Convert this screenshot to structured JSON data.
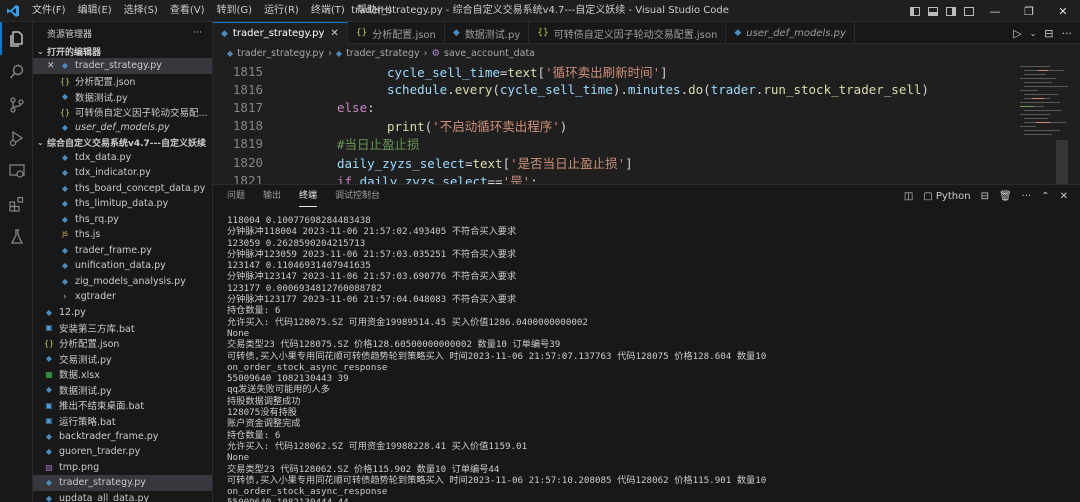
{
  "titlebar": {
    "menu": [
      "文件(F)",
      "编辑(E)",
      "选择(S)",
      "查看(V)",
      "转到(G)",
      "运行(R)",
      "终端(T)",
      "帮助(H)"
    ],
    "title": "trader_strategy.py - 综合自定义交易系统v4.7---自定义妖续 - Visual Studio Code"
  },
  "sidebar": {
    "header": "资源管理器",
    "more": "···",
    "open_editors_title": "打开的编辑器",
    "open_editors": [
      {
        "label": "trader_strategy.py",
        "kind": "py"
      },
      {
        "label": "分析配置.json",
        "kind": "json"
      },
      {
        "label": "数据测试.py",
        "kind": "py"
      },
      {
        "label": "可转债自定义因子轮动交易配...",
        "kind": "json"
      },
      {
        "label": "user_def_models.py",
        "kind": "py"
      }
    ],
    "workspace_title": "综合自定义交易系统v4.7---自定义妖续",
    "files": [
      {
        "label": "tdx_data.py",
        "kind": "py"
      },
      {
        "label": "tdx_indicator.py",
        "kind": "py"
      },
      {
        "label": "ths_board_concept_data.py",
        "kind": "py"
      },
      {
        "label": "ths_limitup_data.py",
        "kind": "py"
      },
      {
        "label": "ths_rq.py",
        "kind": "py"
      },
      {
        "label": "ths.js",
        "kind": "js"
      },
      {
        "label": "trader_frame.py",
        "kind": "py"
      },
      {
        "label": "unification_data.py",
        "kind": "py"
      },
      {
        "label": "zig_models_analysis.py",
        "kind": "py"
      },
      {
        "label": "xgtrader",
        "kind": "folder"
      },
      {
        "label": "12.py",
        "kind": "py"
      },
      {
        "label": "安装第三方库.bat",
        "kind": "bat"
      },
      {
        "label": "分析配置.json",
        "kind": "json"
      },
      {
        "label": "交易测试.py",
        "kind": "py"
      },
      {
        "label": "数据.xlsx",
        "kind": "xlsx"
      },
      {
        "label": "数据测试.py",
        "kind": "py"
      },
      {
        "label": "推出不结束桌面.bat",
        "kind": "bat"
      },
      {
        "label": "运行策略.bat",
        "kind": "bat"
      },
      {
        "label": "backtrader_frame.py",
        "kind": "py"
      },
      {
        "label": "guoren_trader.py",
        "kind": "py"
      },
      {
        "label": "tmp.png",
        "kind": "png"
      },
      {
        "label": "trader_strategy.py",
        "kind": "py"
      },
      {
        "label": "updata_all_data.py",
        "kind": "py"
      }
    ]
  },
  "tabs": [
    {
      "label": "trader_strategy.py",
      "kind": "py"
    },
    {
      "label": "分析配置.json",
      "kind": "json"
    },
    {
      "label": "数据测试.py",
      "kind": "py"
    },
    {
      "label": "可转债自定义因子轮动交易配置.json",
      "kind": "json"
    },
    {
      "label": "user_def_models.py",
      "kind": "py"
    }
  ],
  "breadcrumb": [
    "trader_strategy.py",
    "trader_strategy",
    "save_account_data"
  ],
  "code": {
    "lines": [
      {
        "n": "1815",
        "parts": [
          [
            "v",
            "cycle_sell_time"
          ],
          [
            "p",
            "="
          ],
          [
            "f",
            "text"
          ],
          [
            "p",
            "["
          ],
          [
            "s",
            "'循环卖出刷新时间'"
          ],
          [
            "p",
            "]"
          ]
        ],
        "indent": 1
      },
      {
        "n": "1816",
        "parts": [
          [
            "v",
            "schedule"
          ],
          [
            "p",
            "."
          ],
          [
            "f",
            "every"
          ],
          [
            "p",
            "("
          ],
          [
            "v",
            "cycle_sell_time"
          ],
          [
            "p",
            ")."
          ],
          [
            "v",
            "minutes"
          ],
          [
            "p",
            "."
          ],
          [
            "f",
            "do"
          ],
          [
            "p",
            "("
          ],
          [
            "v",
            "trader"
          ],
          [
            "p",
            "."
          ],
          [
            "f",
            "run_stock_trader_sell"
          ],
          [
            "p",
            ")"
          ]
        ],
        "indent": 1
      },
      {
        "n": "1817",
        "parts": [
          [
            "k",
            "else"
          ],
          [
            "p",
            ":"
          ]
        ],
        "indent": 0
      },
      {
        "n": "1818",
        "parts": [
          [
            "f",
            "print"
          ],
          [
            "p",
            "("
          ],
          [
            "s",
            "'不启动循环卖出程序'"
          ],
          [
            "p",
            ")"
          ]
        ],
        "indent": 1
      },
      {
        "n": "1819",
        "parts": [
          [
            "cm",
            "#当日止盈止损"
          ]
        ],
        "indent": 0
      },
      {
        "n": "1820",
        "parts": [
          [
            "v",
            "daily_zyzs_select"
          ],
          [
            "p",
            "="
          ],
          [
            "f",
            "text"
          ],
          [
            "p",
            "["
          ],
          [
            "s",
            "'是否当日止盈止损'"
          ],
          [
            "p",
            "]"
          ]
        ],
        "indent": 0
      },
      {
        "n": "1821",
        "parts": [
          [
            "k",
            "if"
          ],
          [
            "p",
            " "
          ],
          [
            "v",
            "daily_zyzs_select"
          ],
          [
            "p",
            "=="
          ],
          [
            "s",
            "'是'"
          ],
          [
            "p",
            ":"
          ]
        ],
        "indent": 0
      }
    ]
  },
  "panel": {
    "tabs": [
      "问题",
      "输出",
      "终端",
      "调试控制台"
    ],
    "active_tab": "终端",
    "shell": "Python",
    "terminal": [
      "118004 0.10077698284483438",
      "分钟脉冲118004 2023-11-06 21:57:02.493405 不符合买入要求",
      "123059 0.2628590204215713",
      "分钟脉冲123059 2023-11-06 21:57:03.035251 不符合买入要求",
      "123147 0.11046931407941635",
      "分钟脉冲123147 2023-11-06 21:57:03.690776 不符合买入要求",
      "123177 0.0006934812760088782",
      "分钟脉冲123177 2023-11-06 21:57:04.048083 不符合买入要求",
      "持仓数量: 6",
      "允许买入: 代码128075.SZ 可用资金19989514.45 买入价值1286.0400000000002",
      "None",
      "交易类型23 代码128075.SZ 价格128.60500000000002 数量10 订单编号39",
      "可转债,买入小果专用同花顺可转债趋势轮到策略买入 时间2023-11-06 21:57:07.137763 代码128075 价格128.604 数量10",
      "on_order_stock_async_response",
      "55009640 1082130443 39",
      "qq发送失败可能用的人多",
      "持股数据调整成功",
      "128075没有持股",
      "账户资金调整完成",
      "持仓数量: 6",
      "允许买入: 代码128062.SZ 可用资金19988228.41 买入价值1159.01",
      "None",
      "交易类型23 代码128062.SZ 价格115.902 数量10 订单编号44",
      "可转债,买入小果专用同花顺可转债趋势轮到策略买入 时间2023-11-06 21:57:10.208085 代码128062 价格115.901 数量10",
      "on_order_stock_async_response",
      "55009640 1082130444 44"
    ]
  },
  "colors": {
    "accent": "#0078d4",
    "editor_bg": "#1f1f1f",
    "panel_bg": "#181818"
  },
  "icons": [
    "vscode-logo-icon",
    "explorer-icon",
    "search-icon",
    "source-control-icon",
    "run-debug-icon",
    "remote-explorer-icon",
    "extensions-icon",
    "testing-icon"
  ]
}
